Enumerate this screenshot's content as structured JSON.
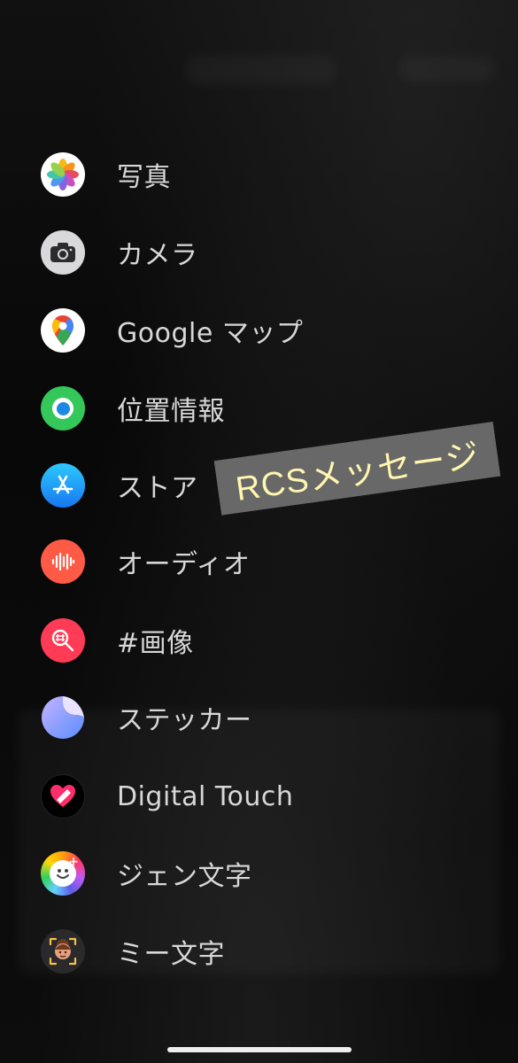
{
  "menu": {
    "items": [
      {
        "label": "写真",
        "icon": "photos-icon"
      },
      {
        "label": "カメラ",
        "icon": "camera-icon"
      },
      {
        "label": "Google マップ",
        "icon": "google-maps-icon"
      },
      {
        "label": "位置情報",
        "icon": "location-icon"
      },
      {
        "label": "ストア",
        "icon": "app-store-icon"
      },
      {
        "label": "オーディオ",
        "icon": "audio-icon"
      },
      {
        "label": "#画像",
        "icon": "image-search-icon"
      },
      {
        "label": "ステッカー",
        "icon": "sticker-icon"
      },
      {
        "label": "Digital Touch",
        "icon": "digital-touch-icon"
      },
      {
        "label": "ジェン文字",
        "icon": "genmoji-icon"
      },
      {
        "label": "ミー文字",
        "icon": "memoji-icon"
      }
    ]
  },
  "annotation": {
    "text": "RCSメッセージ",
    "color": "#fff6b0"
  },
  "colors": {
    "background": "#0a0a0a",
    "label": "#d8d8d8"
  }
}
